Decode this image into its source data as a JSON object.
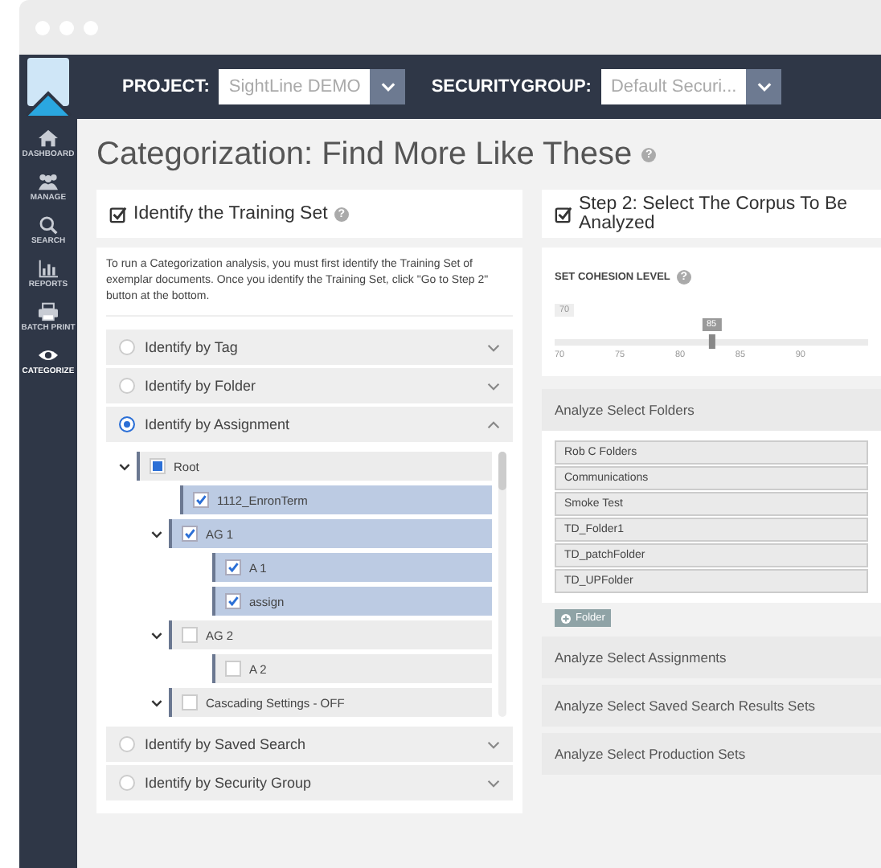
{
  "topbar": {
    "project_label": "PROJECT:",
    "project_value": "SightLine DEMO",
    "group_label": "SECURITYGROUP:",
    "group_value": "Default Securi..."
  },
  "sidebar": {
    "items": [
      {
        "label": "DASHBOARD",
        "kind": "home",
        "selected": false
      },
      {
        "label": "MANAGE",
        "kind": "people",
        "selected": false
      },
      {
        "label": "SEARCH",
        "kind": "search",
        "selected": false
      },
      {
        "label": "REPORTS",
        "kind": "chart",
        "selected": false
      },
      {
        "label": "BATCH PRINT",
        "kind": "print",
        "selected": false
      },
      {
        "label": "CATEGORIZE",
        "kind": "eye",
        "selected": true
      }
    ]
  },
  "page_title": "Categorization: Find More Like These",
  "page_help": "?",
  "step1": {
    "title": "Identify the Training Set",
    "help": "?",
    "description": "To run a Categorization analysis, you must first identify the Training Set of exemplar documents. Once you identify the Training Set, click \"Go to Step 2\" button at the bottom.",
    "options": [
      {
        "label": "Identify by Tag",
        "selected": false,
        "expanded": false
      },
      {
        "label": "Identify by Folder",
        "selected": false,
        "expanded": false
      },
      {
        "label": "Identify by Assignment",
        "selected": true,
        "expanded": true
      },
      {
        "label": "Identify by Saved Search",
        "selected": false,
        "expanded": false
      },
      {
        "label": "Identify by Security Group",
        "selected": false,
        "expanded": false
      }
    ],
    "tree": [
      {
        "label": "Root",
        "checked": false,
        "indeterminate": true,
        "expanded": true,
        "children": [
          {
            "label": "1112_EnronTerm",
            "checked": true
          },
          {
            "label": "AG 1",
            "checked": true,
            "expanded": true,
            "children": [
              {
                "label": "A 1",
                "checked": true
              },
              {
                "label": "assign",
                "checked": true
              }
            ]
          },
          {
            "label": "AG 2",
            "checked": false,
            "expanded": true,
            "children": [
              {
                "label": "A 2",
                "checked": false
              }
            ]
          },
          {
            "label": "Cascading Settings - OFF",
            "checked": false,
            "expanded": true
          }
        ]
      }
    ]
  },
  "step2": {
    "title": "Step 2: Select The Corpus To Be Analyzed",
    "cohesion": {
      "label": "SET COHESION LEVEL",
      "help": "?",
      "min_value": "70",
      "value": "85",
      "level": 0.5,
      "ticks": [
        "70",
        "75",
        "80",
        "85",
        "90"
      ]
    },
    "folders_header": "Analyze Select Folders",
    "folders": [
      "Rob C Folders",
      "Communications",
      "Smoke Test",
      "TD_Folder1",
      "TD_patchFolder",
      "TD_UPFolder"
    ],
    "add_button": "Folder",
    "sections": [
      "Analyze Select Assignments",
      "Analyze Select Saved Search Results Sets",
      "Analyze Select Production Sets"
    ]
  }
}
